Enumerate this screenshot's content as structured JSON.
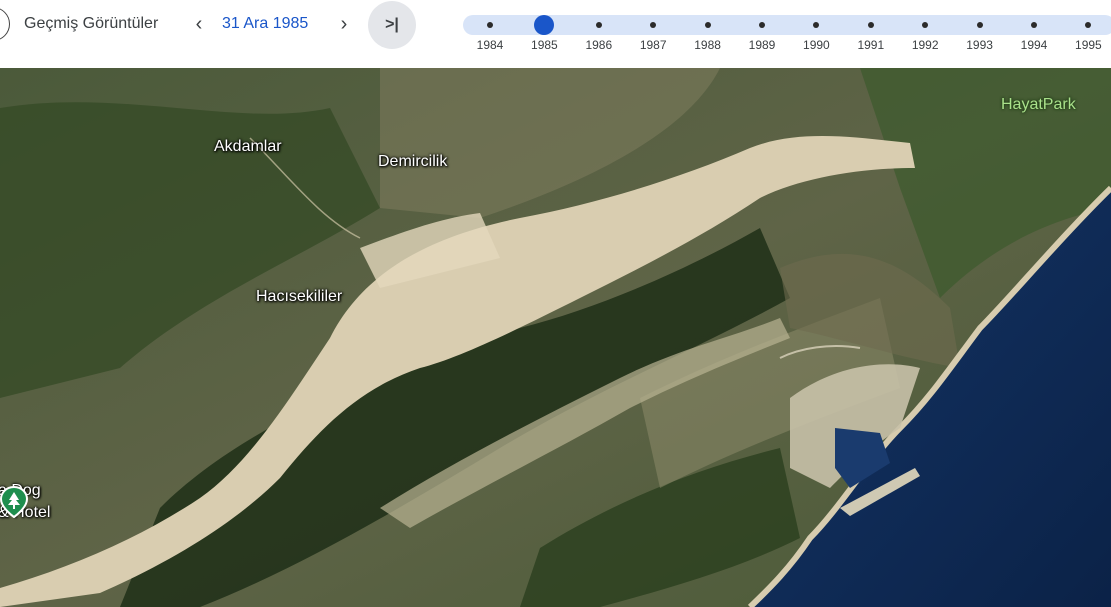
{
  "toolbar": {
    "title": "Geçmiş Görüntüler",
    "prev_icon": "‹",
    "date": "31 Ara 1985",
    "next_icon": "›",
    "latest_icon": ">|"
  },
  "timeline": {
    "years": [
      "1984",
      "1985",
      "1986",
      "1987",
      "1988",
      "1989",
      "1990",
      "1991",
      "1992",
      "1993",
      "1994",
      "1995"
    ],
    "selected_year": "1985",
    "track_color": "#d8e4f8",
    "active_color": "#1a56c9"
  },
  "map": {
    "places": {
      "akdamlar": "Akdamlar",
      "demircilik": "Demircilik",
      "hacisekililer": "Hacısekililer",
      "hayatpark": "HayatPark",
      "dog_hotel_line1": "a Dog",
      "dog_hotel_line2": "& Hotel"
    },
    "poi_icon": "park-pin-icon",
    "sea_color": "#0f2a55",
    "riverbed_color": "#d9cdb0",
    "vegetation_color": "#2f4a24"
  }
}
